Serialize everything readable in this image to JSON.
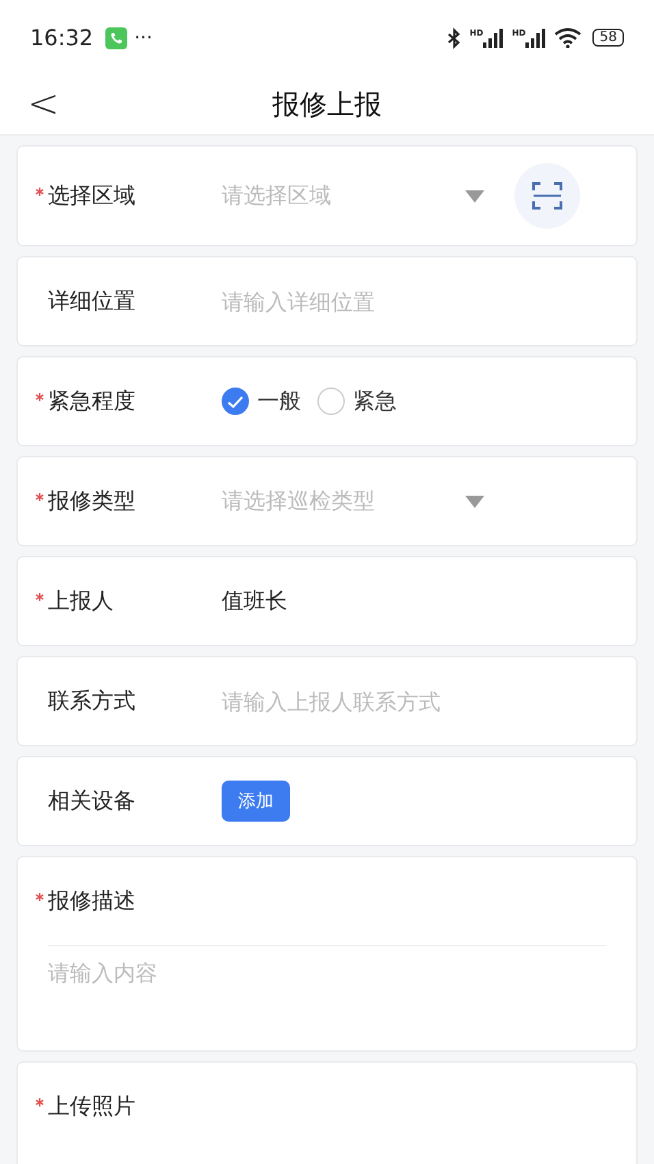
{
  "status_bar": {
    "time": "16:32",
    "more": "···",
    "signal_labels": [
      "HD",
      "HD"
    ],
    "battery": "58"
  },
  "header": {
    "back": "<",
    "title": "报修上报"
  },
  "fields": [
    {
      "kind": "select",
      "label": "选择区域",
      "required": true,
      "placeholder": "请选择区域",
      "scan": true
    },
    {
      "kind": "input",
      "label": "详细位置",
      "required": false,
      "placeholder": "请输入详细位置"
    },
    {
      "kind": "radio",
      "label": "紧急程度",
      "required": true,
      "options": [
        {
          "label": "一般",
          "selected": true
        },
        {
          "label": "紧急",
          "selected": false
        }
      ]
    },
    {
      "kind": "select",
      "label": "报修类型",
      "required": true,
      "placeholder": "请选择巡检类型",
      "scan": false
    },
    {
      "kind": "value",
      "label": "上报人",
      "required": true,
      "value": "值班长"
    },
    {
      "kind": "input",
      "label": "联系方式",
      "required": false,
      "placeholder": "请输入上报人联系方式"
    },
    {
      "kind": "button",
      "label": "相关设备",
      "required": false,
      "button": "添加"
    },
    {
      "kind": "textarea",
      "label": "报修描述",
      "required": true,
      "placeholder": "请输入内容"
    },
    {
      "kind": "upload",
      "label": "上传照片",
      "required": true
    }
  ]
}
